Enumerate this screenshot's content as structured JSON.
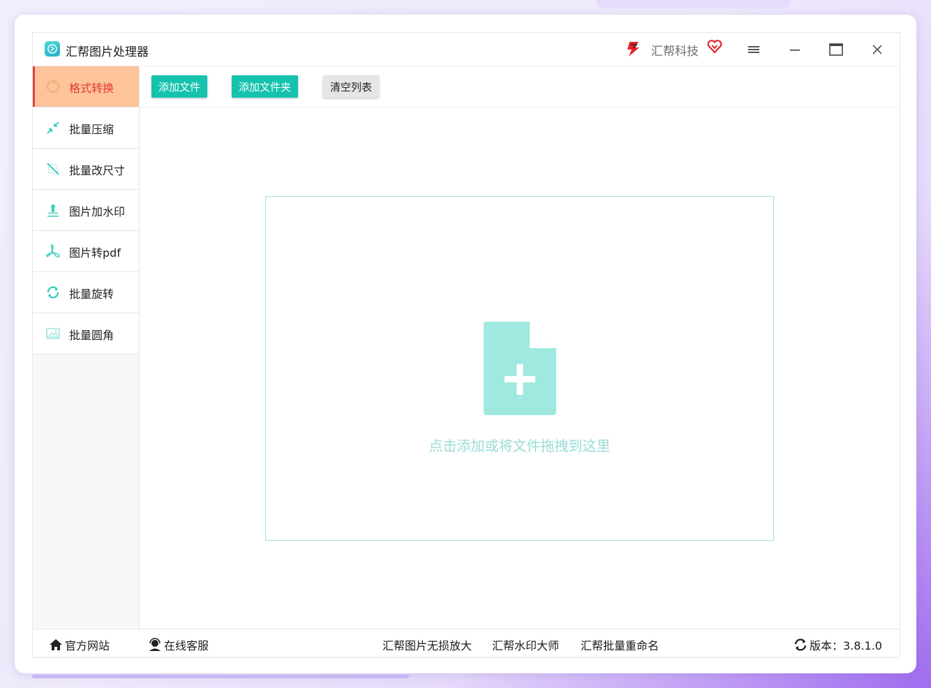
{
  "app": {
    "title": "汇帮图片处理器"
  },
  "brand": {
    "name": "汇帮科技"
  },
  "colors": {
    "accent": "#14c2ad",
    "active_bg": "#fdc39a",
    "active_text": "#e23a2a",
    "drop_border": "#9fe2db"
  },
  "window_controls": {
    "menu_icon": "hamburger-icon",
    "min_icon": "minimize-icon",
    "max_icon": "maximize-icon",
    "close_icon": "close-icon"
  },
  "sidebar": {
    "items": [
      {
        "label": "格式转换",
        "icon": "format-convert-icon",
        "active": true
      },
      {
        "label": "批量压缩",
        "icon": "compress-icon",
        "active": false
      },
      {
        "label": "批量改尺寸",
        "icon": "resize-icon",
        "active": false
      },
      {
        "label": "图片加水印",
        "icon": "watermark-icon",
        "active": false
      },
      {
        "label": "图片转pdf",
        "icon": "pdf-icon",
        "active": false
      },
      {
        "label": "批量旋转",
        "icon": "rotate-icon",
        "active": false
      },
      {
        "label": "批量圆角",
        "icon": "round-corner-icon",
        "active": false
      }
    ]
  },
  "toolbar": {
    "add_file": "添加文件",
    "add_folder": "添加文件夹",
    "clear_list": "清空列表"
  },
  "dropzone": {
    "hint": "点击添加或将文件拖拽到这里",
    "icon": "file-add-icon"
  },
  "footer": {
    "website": "官方网站",
    "support": "在线客服",
    "link1": "汇帮图片无损放大",
    "link2": "汇帮水印大师",
    "link3": "汇帮批量重命名",
    "version": "版本：3.8.1.0"
  }
}
